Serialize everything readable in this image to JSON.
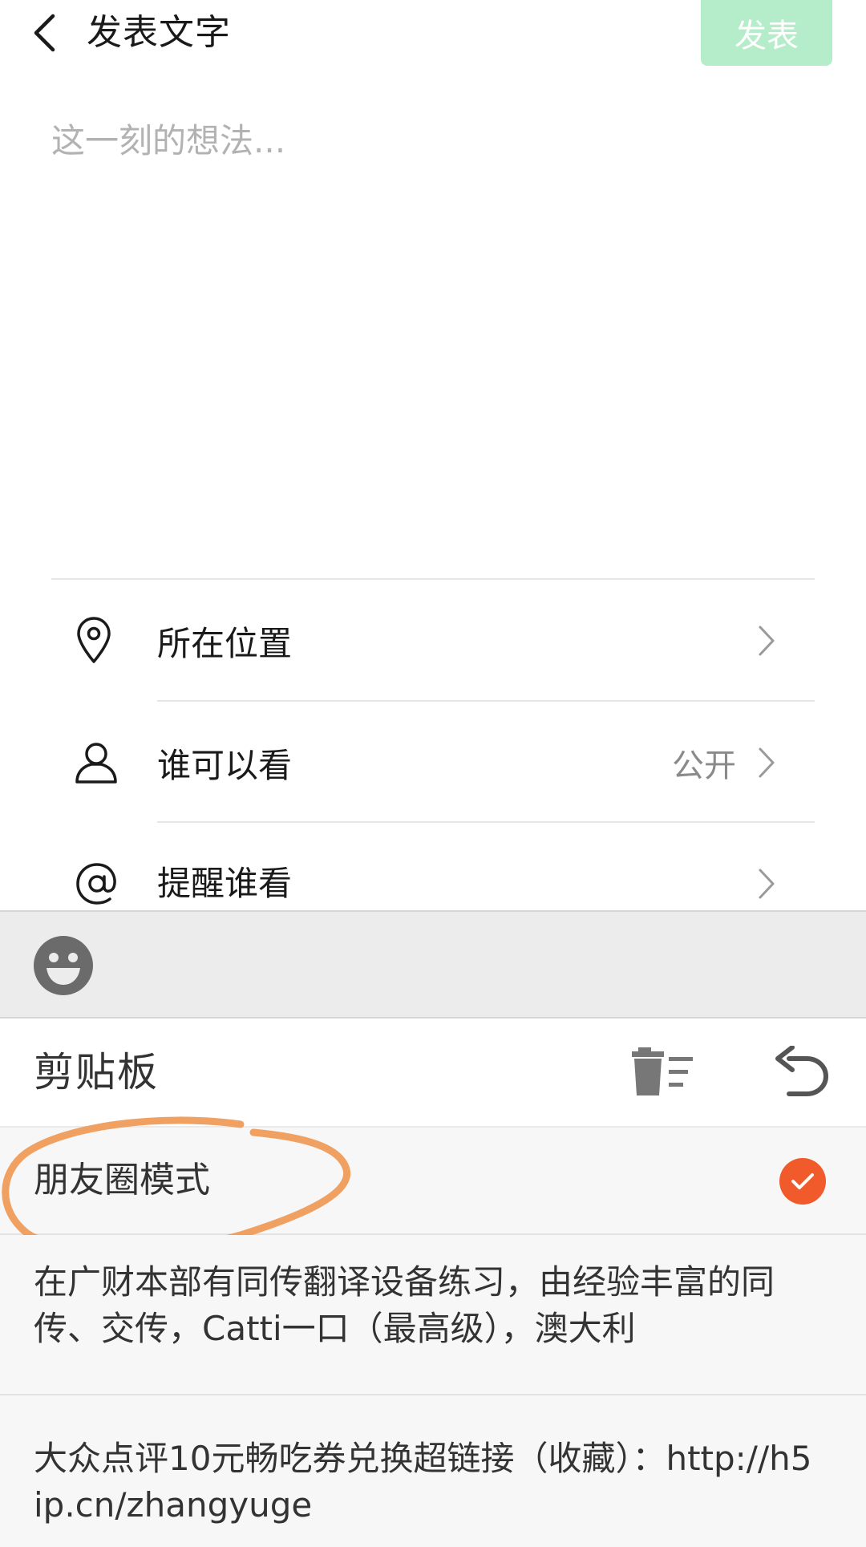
{
  "header": {
    "title": "发表文字",
    "publish_label": "发表"
  },
  "composer": {
    "placeholder": "这一刻的想法..."
  },
  "options": [
    {
      "label": "所在位置",
      "value": "",
      "icon": "location-pin-icon"
    },
    {
      "label": "谁可以看",
      "value": "公开",
      "icon": "person-icon"
    },
    {
      "label": "提醒谁看",
      "value": "",
      "icon": "at-sign-icon"
    }
  ],
  "keyboard": {
    "emoji_icon": "smiley-face-icon"
  },
  "clipboard": {
    "title": "剪贴板",
    "mode_label": "朋友圈模式",
    "mode_checked": true,
    "items": [
      {
        "text": "在广财本部有同传翻译设备练习，由经验丰富的同传、交传，Catti一口（最高级），澳大利"
      },
      {
        "text": "大众点评10元畅吃券兑换超链接（收藏）：http://h5ip.cn/zhangyuge"
      }
    ]
  },
  "colors": {
    "publish_bg": "#b5ecc9",
    "check_badge": "#f15a2b",
    "annotation": "#f0a060"
  }
}
